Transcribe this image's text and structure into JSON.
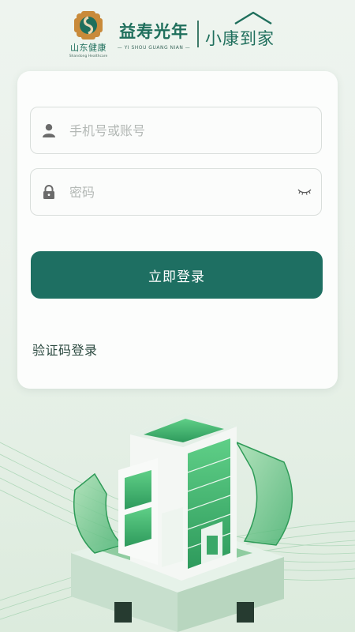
{
  "brand": {
    "shandong": {
      "name_cn": "山东健康",
      "name_en": "Shandong Healthcare"
    },
    "yishou": {
      "name_cn": "益寿光年",
      "name_en": "— YI SHOU GUANG NIAN —"
    },
    "xiaokang": {
      "name_cn": "小康到家"
    }
  },
  "login": {
    "account": {
      "placeholder": "手机号或账号",
      "value": "",
      "icon": "user-icon"
    },
    "password": {
      "placeholder": "密码",
      "value": "",
      "icon": "lock-icon",
      "toggle_icon": "eye-closed-icon"
    },
    "submit_label": "立即登录",
    "alt_login_label": "验证码登录"
  },
  "colors": {
    "primary": "#1e6f62",
    "brand_green": "#1f6f5c",
    "background": "#eef4ef",
    "card": "#fcfdfc",
    "placeholder": "#b3b8b5"
  }
}
